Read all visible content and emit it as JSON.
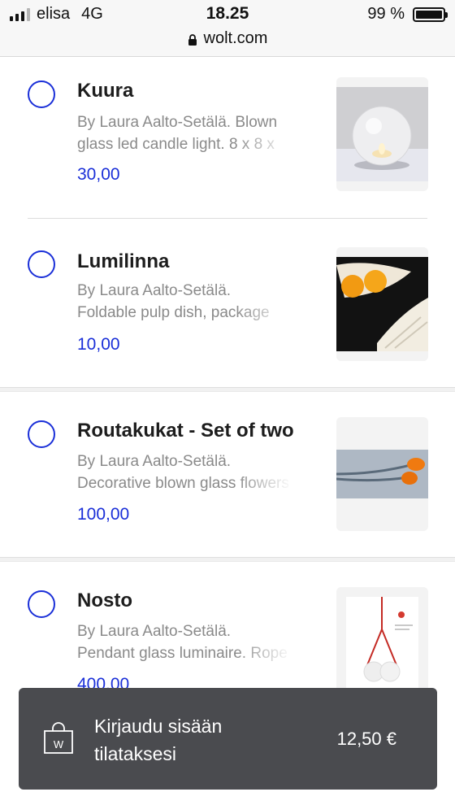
{
  "status_bar": {
    "carrier": "elisa",
    "network": "4G",
    "time": "18.25",
    "battery": "99 %",
    "url": "wolt.com"
  },
  "items": [
    {
      "title": "Kuura",
      "description": "By Laura Aalto-Setälä. Blown glass led candle light. 8 x 8 x",
      "price": "30,00",
      "image": "glass-candle-light"
    },
    {
      "title": "Lumilinna",
      "description": "By Laura Aalto-Setälä. Foldable pulp dish, package includes",
      "price": "10,00",
      "image": "pulp-dish-with-oranges"
    },
    {
      "title": "Routakukat - Set of two",
      "description": "By Laura Aalto-Setälä. Decorative blown glass flowers",
      "price": "100,00",
      "image": "orange-glass-flowers"
    },
    {
      "title": "Nosto",
      "description": "By Laura Aalto-Setälä. Pendant glass luminaire. Rope color r",
      "price": "400,00",
      "image": "pendant-luminaire-poster"
    }
  ],
  "cart_bar": {
    "label": "Kirjaudu sisään tilataksesi",
    "total": "12,50 €",
    "icon": "shopping-bag-w-icon"
  },
  "colors": {
    "accent": "#1a2fd8",
    "cart_bar": "#4a4b4f"
  }
}
